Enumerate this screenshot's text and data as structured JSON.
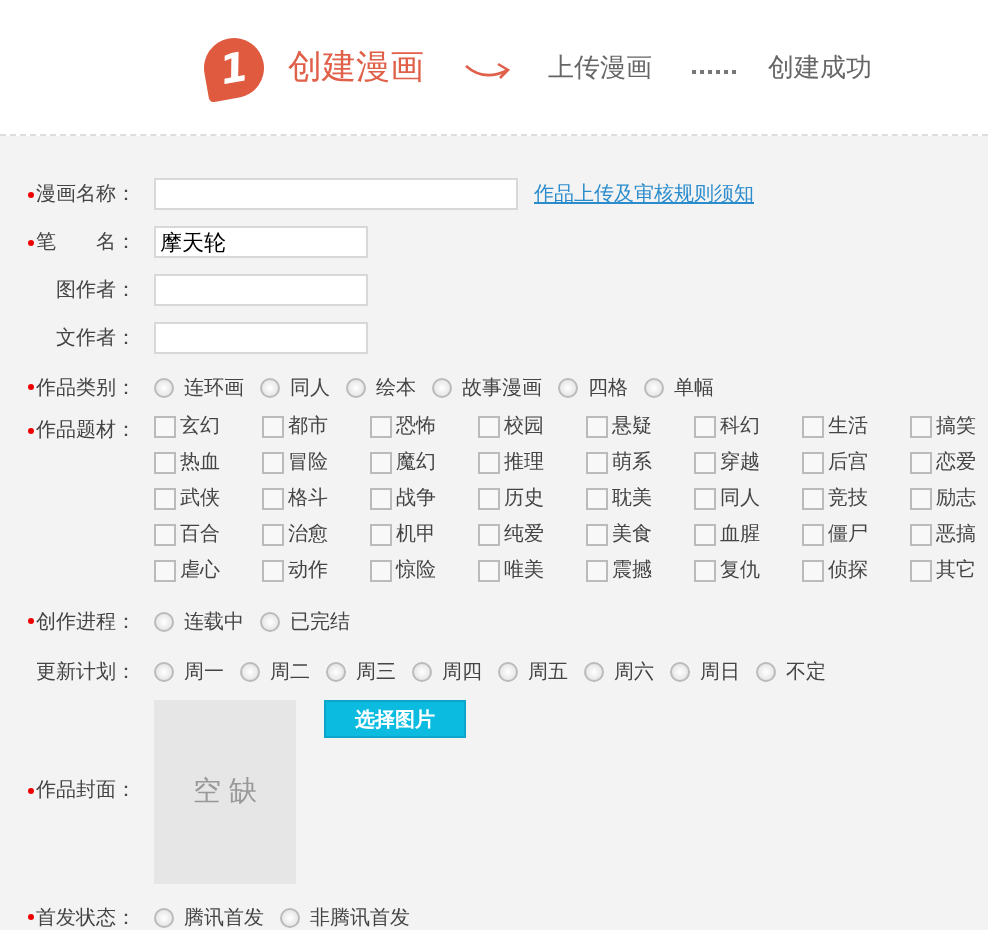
{
  "steps": [
    {
      "number": "1",
      "label": "创建漫画",
      "selected": true
    },
    {
      "label": "上传漫画",
      "selected": false
    },
    {
      "label": "创建成功",
      "selected": false
    }
  ],
  "fields": [
    {
      "kind": "text",
      "label": "漫画名称：",
      "required": true,
      "link": "作品上传及审核规则须知"
    },
    {
      "kind": "text",
      "label": "笔　　名：",
      "required": true,
      "value": "摩天轮"
    },
    {
      "kind": "text",
      "label": "图作者：",
      "required": false
    },
    {
      "kind": "text",
      "label": "文作者：",
      "required": false
    },
    {
      "kind": "radio",
      "label": "作品类别：",
      "required": true,
      "options": [
        {
          "label": "连环画",
          "selected": false
        },
        {
          "label": "同人",
          "selected": false
        },
        {
          "label": "绘本",
          "selected": false
        },
        {
          "label": "故事漫画",
          "selected": false
        },
        {
          "label": "四格",
          "selected": false
        },
        {
          "label": "单幅",
          "selected": false
        }
      ]
    },
    {
      "kind": "checkbox",
      "label": "作品题材：",
      "required": true,
      "options": [
        {
          "label": "玄幻",
          "checked": false
        },
        {
          "label": "都市",
          "checked": false
        },
        {
          "label": "恐怖",
          "checked": false
        },
        {
          "label": "校园",
          "checked": false
        },
        {
          "label": "悬疑",
          "checked": false
        },
        {
          "label": "科幻",
          "checked": false
        },
        {
          "label": "生活",
          "checked": false
        },
        {
          "label": "搞笑",
          "checked": false
        },
        {
          "label": "热血",
          "checked": false
        },
        {
          "label": "冒险",
          "checked": false
        },
        {
          "label": "魔幻",
          "checked": false
        },
        {
          "label": "推理",
          "checked": false
        },
        {
          "label": "萌系",
          "checked": false
        },
        {
          "label": "穿越",
          "checked": false
        },
        {
          "label": "后宫",
          "checked": false
        },
        {
          "label": "恋爱",
          "checked": false
        },
        {
          "label": "武侠",
          "checked": false
        },
        {
          "label": "格斗",
          "checked": false
        },
        {
          "label": "战争",
          "checked": false
        },
        {
          "label": "历史",
          "checked": false
        },
        {
          "label": "耽美",
          "checked": false
        },
        {
          "label": "同人",
          "checked": false
        },
        {
          "label": "竞技",
          "checked": false
        },
        {
          "label": "励志",
          "checked": false
        },
        {
          "label": "百合",
          "checked": false
        },
        {
          "label": "治愈",
          "checked": false
        },
        {
          "label": "机甲",
          "checked": false
        },
        {
          "label": "纯爱",
          "checked": false
        },
        {
          "label": "美食",
          "checked": false
        },
        {
          "label": "血腥",
          "checked": false
        },
        {
          "label": "僵尸",
          "checked": false
        },
        {
          "label": "恶搞",
          "checked": false
        },
        {
          "label": "虐心",
          "checked": false
        },
        {
          "label": "动作",
          "checked": false
        },
        {
          "label": "惊险",
          "checked": false
        },
        {
          "label": "唯美",
          "checked": false
        },
        {
          "label": "震撼",
          "checked": false
        },
        {
          "label": "复仇",
          "checked": false
        },
        {
          "label": "侦探",
          "checked": false
        },
        {
          "label": "其它",
          "checked": false
        }
      ]
    },
    {
      "kind": "radio",
      "label": "创作进程：",
      "required": true,
      "options": [
        {
          "label": "连载中",
          "selected": false
        },
        {
          "label": "已完结",
          "selected": false
        }
      ]
    },
    {
      "kind": "radio",
      "label": "更新计划：",
      "required": false,
      "options": [
        {
          "label": "周一",
          "selected": false
        },
        {
          "label": "周二",
          "selected": false
        },
        {
          "label": "周三",
          "selected": false
        },
        {
          "label": "周四",
          "selected": false
        },
        {
          "label": "周五",
          "selected": false
        },
        {
          "label": "周六",
          "selected": false
        },
        {
          "label": "周日",
          "selected": false
        },
        {
          "label": "不定",
          "selected": false
        }
      ]
    },
    {
      "kind": "cover",
      "label": "作品封面：",
      "required": true,
      "empty_text": "空 缺",
      "button": "选择图片"
    },
    {
      "kind": "radio",
      "label": "首发状态：",
      "required": true,
      "options": [
        {
          "label": "腾讯首发",
          "selected": false
        },
        {
          "label": "非腾讯首发",
          "selected": false
        }
      ]
    }
  ]
}
